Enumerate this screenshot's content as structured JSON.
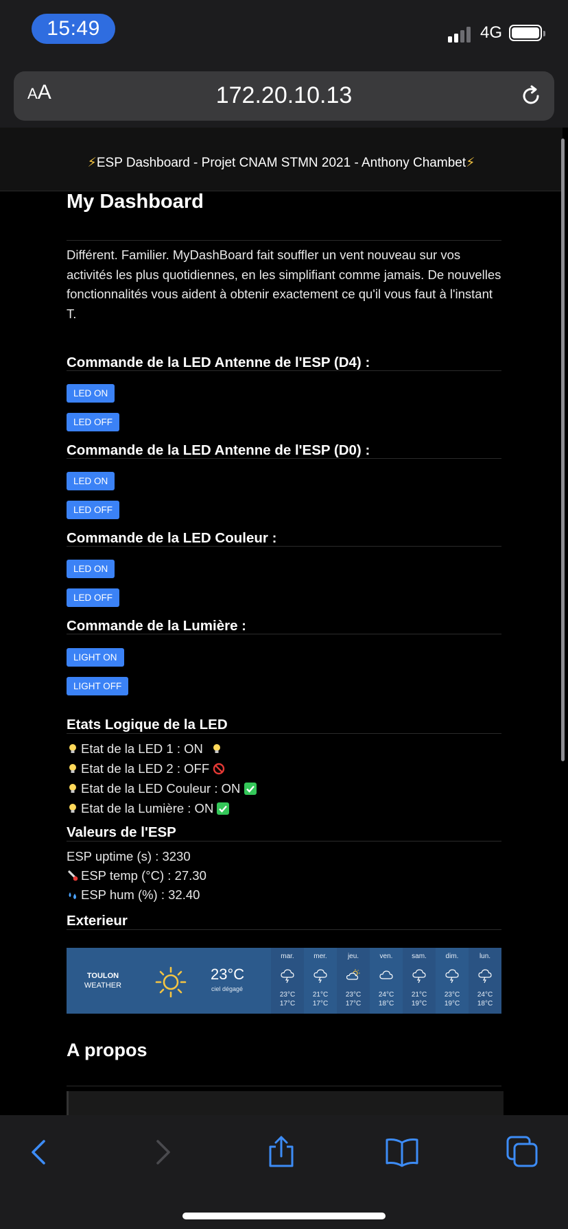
{
  "status_bar": {
    "time": "15:49",
    "network": "4G"
  },
  "safari": {
    "aa_label": "AA",
    "url": "172.20.10.13"
  },
  "site": {
    "header_title": "ESP Dashboard - Projet CNAM STMN 2021 - Anthony Chambet",
    "heading": "My Dashboard",
    "intro": "Différent. Familier. MyDashBoard fait souffler un vent nouveau sur vos activités les plus quotidiennes, en les simplifiant comme jamais. De nouvelles fonctionnalités vous aident à obtenir exactement ce qu'il vous faut à l'instant T."
  },
  "controls": [
    {
      "title": "Commande de la LED Antenne de l'ESP (D4) :",
      "on": "LED ON",
      "off": "LED OFF"
    },
    {
      "title": "Commande de la LED Antenne de l'ESP (D0) :",
      "on": "LED ON",
      "off": "LED OFF"
    },
    {
      "title": "Commande de la LED Couleur :",
      "on": "LED ON",
      "off": "LED OFF"
    },
    {
      "title": "Commande de la Lumière :",
      "on": "LIGHT ON",
      "off": "LIGHT OFF"
    }
  ],
  "states": {
    "title": "Etats Logique de la LED",
    "led1": "Etat de la LED 1 : ON",
    "led2": "Etat de la LED 2 : OFF",
    "led_color": "Etat de la LED Couleur : ON",
    "light": "Etat de la Lumière : ON"
  },
  "esp_values": {
    "title": "Valeurs de l'ESP",
    "uptime": "ESP uptime (s) : 3230",
    "temp": "ESP temp (°C) : 27.30",
    "hum": "ESP hum (%) : 32.40"
  },
  "exterior": {
    "title": "Exterieur",
    "city": "TOULON",
    "city_sub": "WEATHER",
    "current_temp": "23°C",
    "current_desc": "ciel dégagé",
    "forecast": [
      {
        "day": "mar.",
        "icon": "rain-cloud-icon",
        "hi": "23°C",
        "lo": "17°C"
      },
      {
        "day": "mer.",
        "icon": "rain-cloud-icon",
        "hi": "21°C",
        "lo": "17°C"
      },
      {
        "day": "jeu.",
        "icon": "partly-sunny-icon",
        "hi": "23°C",
        "lo": "17°C"
      },
      {
        "day": "ven.",
        "icon": "cloud-icon",
        "hi": "24°C",
        "lo": "18°C"
      },
      {
        "day": "sam.",
        "icon": "rain-cloud-icon",
        "hi": "21°C",
        "lo": "19°C"
      },
      {
        "day": "dim.",
        "icon": "rain-cloud-icon",
        "hi": "23°C",
        "lo": "19°C"
      },
      {
        "day": "lun.",
        "icon": "rain-cloud-icon",
        "hi": "24°C",
        "lo": "18°C"
      }
    ]
  },
  "about": {
    "title": "A propos"
  },
  "colors": {
    "button_blue": "#3b82f6",
    "time_pill": "#2f6de0",
    "weather_bg": "#2c5a8c",
    "toolbar_icons": "#3d8cf6"
  }
}
